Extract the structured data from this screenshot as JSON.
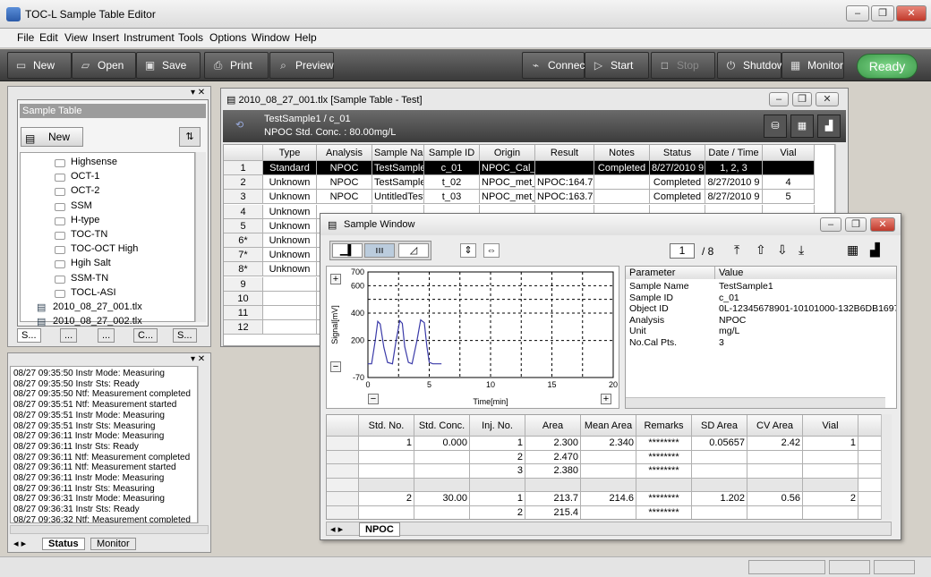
{
  "window": {
    "title": "TOC-L Sample Table Editor"
  },
  "menu": [
    "File",
    "Edit",
    "View",
    "Insert",
    "Instrument",
    "Tools",
    "Options",
    "Window",
    "Help"
  ],
  "toolbar": {
    "new": "New",
    "open": "Open",
    "save": "Save",
    "print": "Print",
    "preview": "Preview",
    "connect": "Connect",
    "start": "Start",
    "stop": "Stop",
    "shutdown": "Shutdown",
    "monitor": "Monitor",
    "status": "Ready"
  },
  "left_panel": {
    "title": "Sample Table",
    "new_label": "New",
    "tree": [
      "Highsense",
      "OCT-1",
      "OCT-2",
      "SSM",
      "H-type",
      "TOC-TN",
      "TOC-OCT High",
      "Hgih Salt",
      "SSM-TN",
      "TOCL-ASI"
    ],
    "files": [
      "2010_08_27_001.tlx",
      "2010_08_27_002.tlx"
    ],
    "tabs": [
      "S...",
      "...",
      "...",
      "C...",
      "S..."
    ]
  },
  "log": {
    "lines": [
      "08/27  09:35:50  Instr Mode: Measuring",
      "08/27  09:35:50  Instr Sts: Ready",
      "08/27  09:35:50  Ntf:    Measurement completed",
      "08/27  09:35:51  Ntf:    Measurement started",
      "08/27  09:35:51  Instr Mode: Measuring",
      "08/27  09:35:51  Instr Sts: Measuring",
      "08/27  09:36:11  Instr Mode: Measuring",
      "08/27  09:36:11  Instr Sts: Ready",
      "08/27  09:36:11  Ntf:    Measurement completed",
      "08/27  09:36:11  Ntf:    Measurement started",
      "08/27  09:36:11  Instr Mode: Measuring",
      "08/27  09:36:11  Instr Sts: Measuring",
      "08/27  09:36:31  Instr Mode: Measuring",
      "08/27  09:36:31  Instr Sts: Ready",
      "08/27  09:36:32  Ntf:    Measurement completed"
    ],
    "tabs": [
      "Status",
      "Monitor"
    ]
  },
  "sample_table": {
    "title": "2010_08_27_001.tlx  [Sample Table - Test]",
    "head1": "TestSample1 / c_01",
    "head2": "NPOC Std. Conc. : 80.00mg/L",
    "columns": [
      "Type",
      "Analysis",
      "Sample Nam",
      "Sample ID",
      "Origin",
      "Result",
      "Notes",
      "Status",
      "Date / Time",
      "Vial"
    ],
    "rows": [
      [
        "1",
        "Standard",
        "NPOC",
        "TestSample1",
        "c_01",
        "NPOC_Cal_",
        "",
        "Completed",
        "8/27/2010 9",
        "1, 2, 3"
      ],
      [
        "2",
        "Unknown",
        "NPOC",
        "TestSample1",
        "t_02",
        "NPOC_met_",
        "NPOC:164.7",
        "",
        "Completed",
        "8/27/2010 9",
        "4"
      ],
      [
        "3",
        "Unknown",
        "NPOC",
        "UntitledTestS",
        "t_03",
        "NPOC_met_",
        "NPOC:163.7",
        "",
        "Completed",
        "8/27/2010 9",
        "5"
      ],
      [
        "4",
        "Unknown"
      ],
      [
        "5",
        "Unknown"
      ],
      [
        "6*",
        "Unknown"
      ],
      [
        "7*",
        "Unknown"
      ],
      [
        "8*",
        "Unknown"
      ],
      [
        "9"
      ],
      [
        "10"
      ],
      [
        "11"
      ],
      [
        "12"
      ]
    ]
  },
  "sample_window": {
    "title": "Sample Window",
    "page": "1",
    "page_total": "/ 8",
    "chart_data": {
      "type": "line",
      "xlabel": "Time[min]",
      "ylabel": "Signal[mV]",
      "xlim": [
        0,
        20
      ],
      "ylim": [
        -70,
        700
      ],
      "xticks": [
        "0",
        "5",
        "10",
        "15",
        "20"
      ],
      "yticks": [
        "700",
        "600",
        "400",
        "200",
        "-70"
      ],
      "x": [
        0,
        0.3,
        0.6,
        0.8,
        1.0,
        1.3,
        1.6,
        2.0,
        2.3,
        2.6,
        2.8,
        3.0,
        3.3,
        3.6,
        4.0,
        4.3,
        4.6,
        4.8,
        5.0,
        5.3,
        5.6,
        6.0
      ],
      "series": [
        {
          "values": [
            30,
            30,
            200,
            340,
            320,
            150,
            40,
            30,
            200,
            345,
            325,
            155,
            40,
            30,
            200,
            350,
            330,
            160,
            40,
            30,
            30,
            30
          ]
        }
      ]
    },
    "params": {
      "header": [
        "Parameter",
        "Value"
      ],
      "rows": [
        [
          "Sample Name",
          "TestSample1"
        ],
        [
          "Sample ID",
          "c_01"
        ],
        [
          "Object ID",
          "0L-12345678901-10101000-132B6DB1697..."
        ],
        [
          "Analysis",
          "NPOC"
        ],
        [
          "Unit",
          "mg/L"
        ],
        [
          "No.Cal Pts.",
          "3"
        ]
      ]
    },
    "cal_columns": [
      "Std. No.",
      "Std. Conc.",
      "Inj. No.",
      "Area",
      "Mean Area",
      "Remarks",
      "SD Area",
      "CV Area",
      "Vial"
    ],
    "cal_rows": [
      [
        "1",
        "0.000",
        "1",
        "2.300",
        "2.340",
        "********",
        "0.05657",
        "2.42",
        "1"
      ],
      [
        "",
        "",
        "2",
        "2.470",
        "",
        "********",
        "",
        "",
        ""
      ],
      [
        "",
        "",
        "3",
        "2.380",
        "",
        "********",
        "",
        "",
        ""
      ],
      [
        "",
        "",
        "",
        "",
        "",
        "",
        "",
        "",
        ""
      ],
      [
        "2",
        "30.00",
        "1",
        "213.7",
        "214.6",
        "********",
        "1.202",
        "0.56",
        "2"
      ],
      [
        "",
        "",
        "2",
        "215.4",
        "",
        "********",
        "",
        "",
        ""
      ]
    ],
    "tab": "NPOC"
  }
}
